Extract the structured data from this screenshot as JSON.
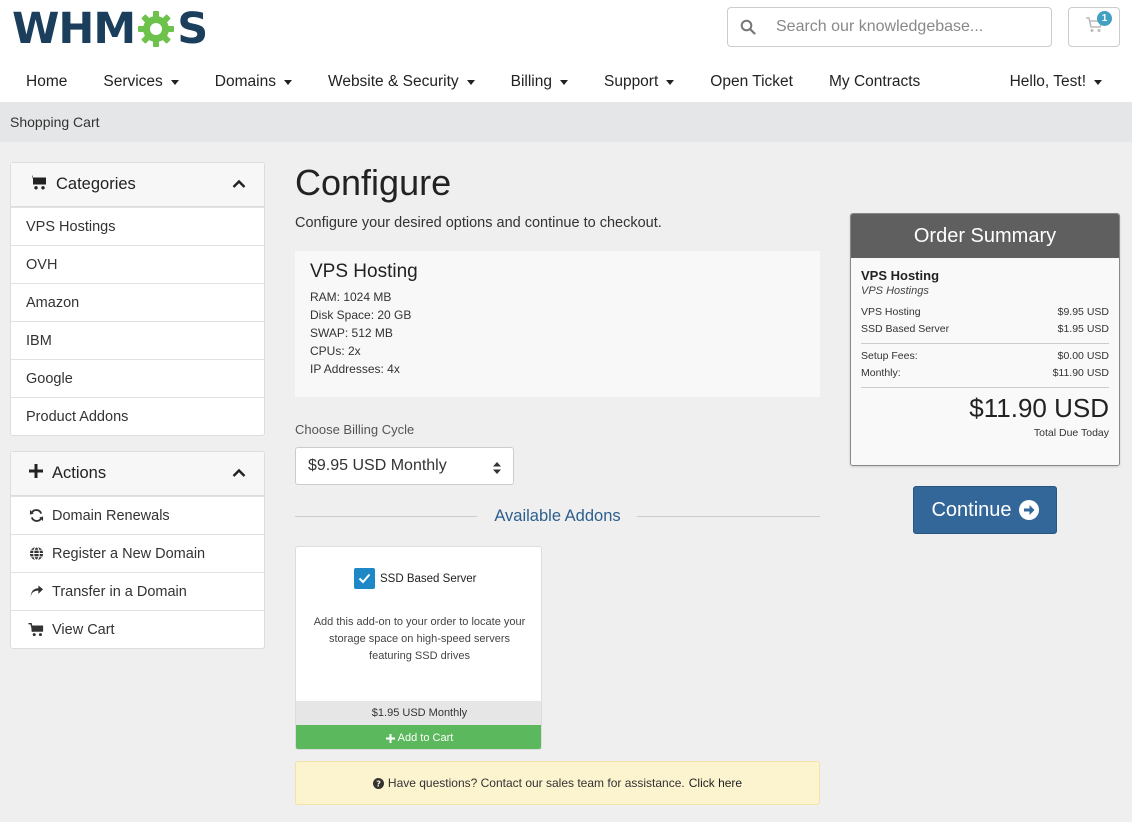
{
  "header": {
    "logo_text": "WHMCS",
    "search_placeholder": "Search our knowledgebase...",
    "cart_count": "1",
    "nav": [
      {
        "label": "Home"
      },
      {
        "label": "Services"
      },
      {
        "label": "Domains"
      },
      {
        "label": "Website & Security"
      },
      {
        "label": "Billing"
      },
      {
        "label": "Support"
      },
      {
        "label": "Open Ticket"
      },
      {
        "label": "My Contracts"
      }
    ],
    "user_menu": "Hello, Test!"
  },
  "breadcrumb": "Shopping Cart",
  "sidebar": {
    "categories": {
      "title": "Categories",
      "items": [
        "VPS Hostings",
        "OVH",
        "Amazon",
        "IBM",
        "Google",
        "Product Addons"
      ]
    },
    "actions": {
      "title": "Actions",
      "items": [
        "Domain Renewals",
        "Register a New Domain",
        "Transfer in a Domain",
        "View Cart"
      ]
    }
  },
  "main": {
    "title": "Configure",
    "subtitle": "Configure your desired options and continue to checkout.",
    "product": {
      "name": "VPS Hosting",
      "specs": [
        "RAM: 1024 MB",
        "Disk Space: 20 GB",
        "SWAP: 512 MB",
        "CPUs: 2x",
        "IP Addresses: 4x"
      ]
    },
    "billing_label": "Choose Billing Cycle",
    "billing_value": "$9.95 USD Monthly",
    "addons_title": "Available Addons",
    "addon": {
      "name": "SSD Based Server",
      "desc_prefix": "Add this add-on to your order to locate your storage space on high-speed servers featuring ",
      "desc_bold": "SSD",
      "desc_suffix": " drives",
      "price": "$1.95 USD Monthly",
      "button": "Add to Cart",
      "checked": true
    },
    "help": {
      "text": "Have questions? Contact our sales team for assistance.",
      "link": "Click here"
    }
  },
  "summary": {
    "title": "Order Summary",
    "product": "VPS Hosting",
    "group": "VPS Hostings",
    "lines": [
      {
        "label": "VPS Hosting",
        "value": "$9.95 USD"
      },
      {
        "label": "SSD Based Server",
        "value": "$1.95 USD"
      }
    ],
    "fees": [
      {
        "label": "Setup Fees:",
        "value": "$0.00 USD"
      },
      {
        "label": "Monthly:",
        "value": "$11.90 USD"
      }
    ],
    "total": "$11.90 USD",
    "total_label": "Total Due Today"
  },
  "continue_label": "Continue",
  "colors": {
    "brand_navy": "#1a3e5c",
    "brand_green": "#6cc24a",
    "primary_button": "#336699",
    "success": "#5cb85c",
    "summary_header": "#5f5f5f"
  }
}
